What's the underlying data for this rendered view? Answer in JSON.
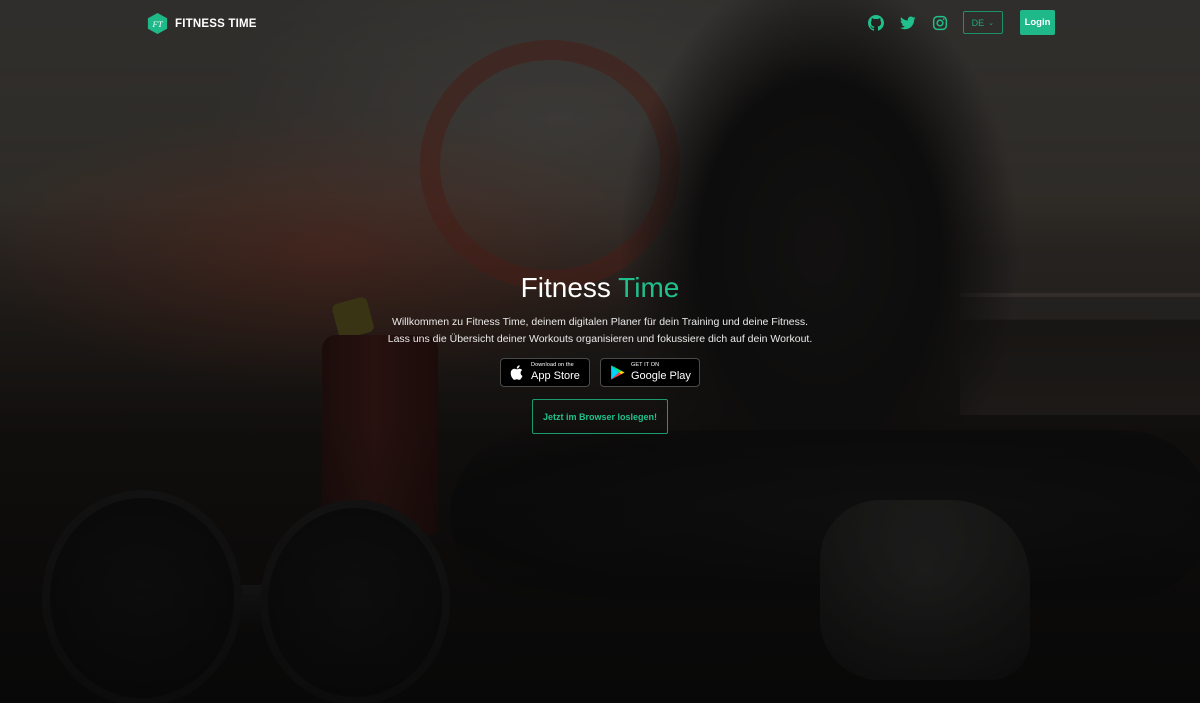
{
  "brand": {
    "logo_text": "FT",
    "name": "FITNESS TIME"
  },
  "header": {
    "social_icons": [
      "github-icon",
      "twitter-icon",
      "instagram-icon"
    ],
    "language": "DE",
    "login_label": "Login"
  },
  "hero": {
    "title_part1": "Fitness",
    "title_part2": "Time",
    "line1": "Willkommen zu Fitness Time, deinem digitalen Planer für dein Training und deine Fitness.",
    "line2": "Lass uns die Übersicht deiner Workouts organisieren und fokussiere dich auf dein Workout.",
    "app_store_small": "Download on the",
    "app_store_big": "App Store",
    "google_play_small": "GET IT ON",
    "google_play_big": "Google Play",
    "cta_label": "Jetzt im Browser loslegen!"
  },
  "colors": {
    "accent": "#20c08c",
    "login_bg": "#1fb889",
    "text": "#ffffff"
  }
}
